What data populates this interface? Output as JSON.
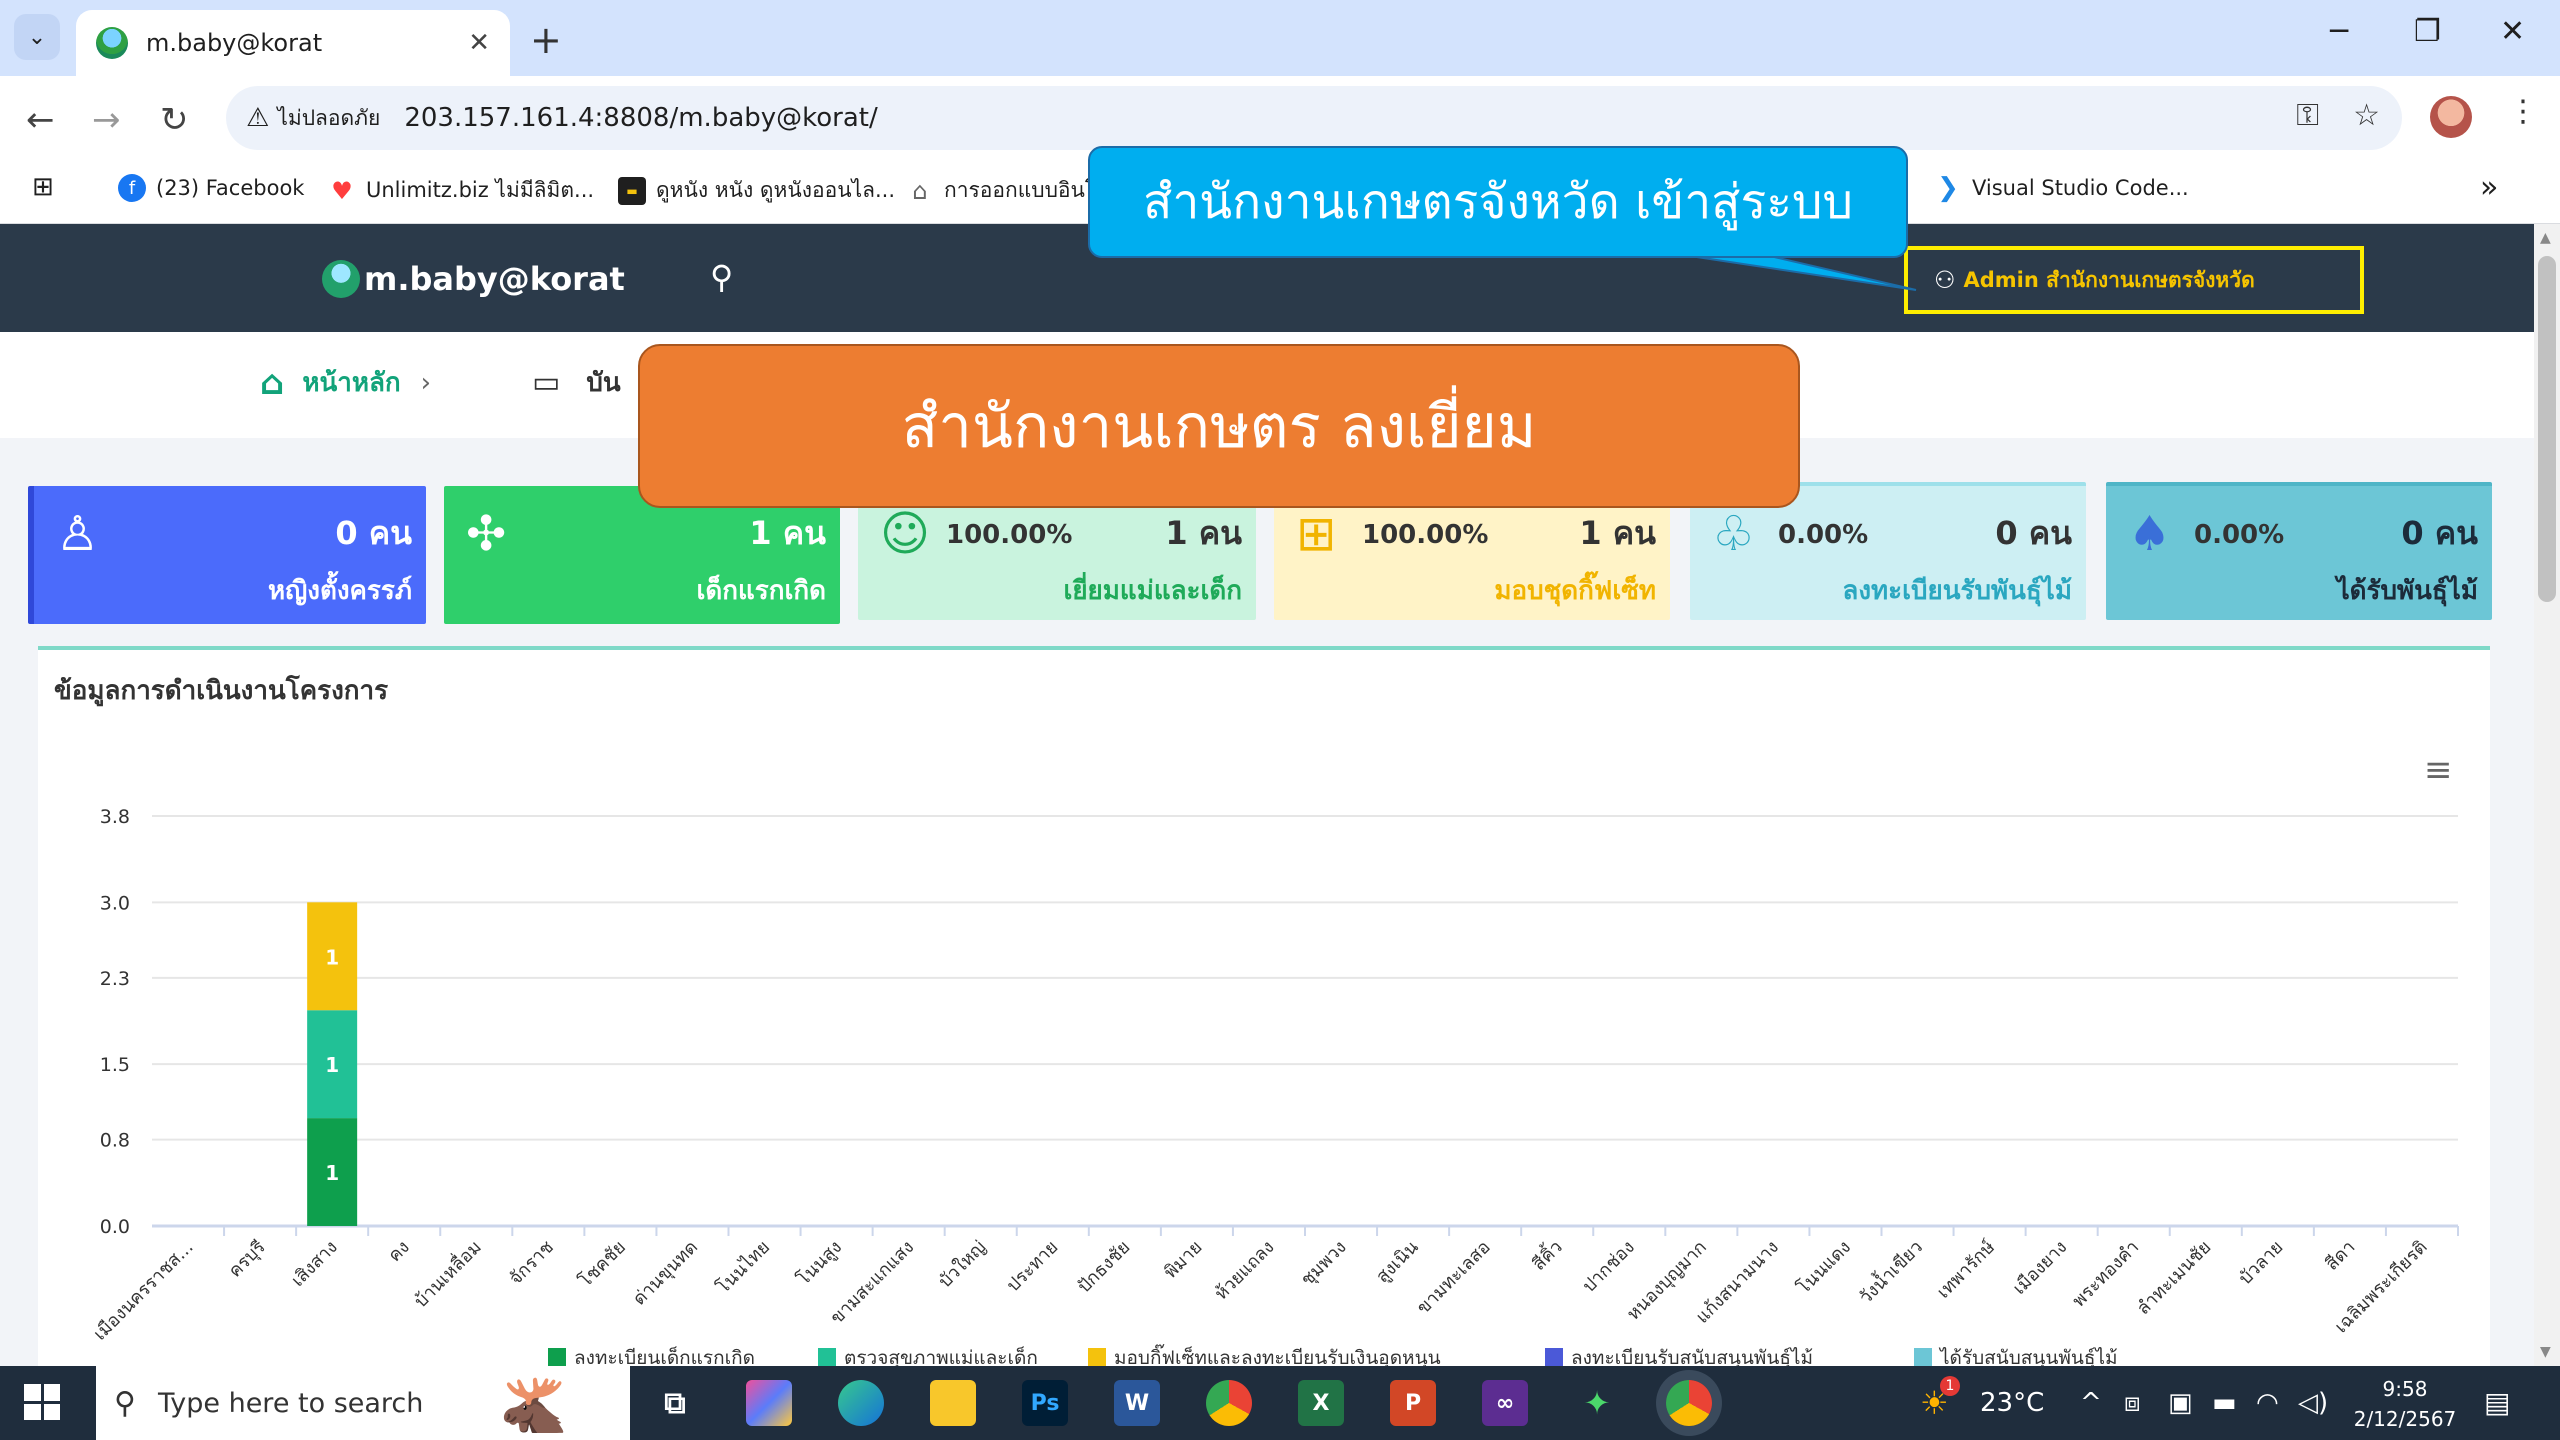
{
  "browser": {
    "tab_title": "m.baby@korat",
    "tab_close": "✕",
    "new_tab": "+",
    "security_warning": "ไม่ปลอดภัย",
    "url": "203.157.161.4:8808/m.baby@korat/",
    "bookmarks": [
      {
        "label": "(23) Facebook",
        "color": "#1877f2"
      },
      {
        "label": "Unlimitz.biz ไม่มีลิมิต...",
        "color": "#ff3d3d"
      },
      {
        "label": "ดูหนัง หนัง ดูหนังออนไล...",
        "color": "#1f1f1f"
      },
      {
        "label": "การออกแบบอินโ",
        "color": "#666666"
      },
      {
        "label": "Visual Studio Code...",
        "color": "#1e88e5"
      }
    ],
    "more_bookmarks": "»"
  },
  "site": {
    "logo_text": "m.baby@korat",
    "admin_label": "Admin สำนักงานเกษตรจังหวัด",
    "breadcrumb": {
      "home": "หน้าหลัก",
      "second": "บัน"
    }
  },
  "stats": [
    {
      "count": "0 คน",
      "label": "หญิงตั้งครรภ์",
      "pct": "",
      "icon": "pregnant-icon",
      "bg": "#4b6bfb",
      "fg": "#ffffff"
    },
    {
      "count": "1 คน",
      "label": "เด็กแรกเกิด",
      "pct": "",
      "icon": "baby-icon",
      "bg": "#2fcf6b",
      "fg": "#ffffff"
    },
    {
      "count": "1 คน",
      "label": "เยี่ยมแม่และเด็ก",
      "pct": "100.00%",
      "icon": "mother-child-icon",
      "bg": "#c9f3de",
      "fg": "#1faa59"
    },
    {
      "count": "1 คน",
      "label": "มอบชุดกิ๊ฟเซ็ท",
      "pct": "100.00%",
      "icon": "gift-icon",
      "bg": "#fff3c7",
      "fg": "#f1b400"
    },
    {
      "count": "0 คน",
      "label": "ลงทะเบียนรับพันธุ์ไม้",
      "pct": "0.00%",
      "icon": "tree-register-icon",
      "bg": "#cdeff3",
      "fg": "#2aa7c0"
    },
    {
      "count": "0 คน",
      "label": "ได้รับพันธุ์ไม้",
      "pct": "0.00%",
      "icon": "tree-icon",
      "bg": "#6cc6d6",
      "fg": "#1c4f8a"
    }
  ],
  "card": {
    "title": "ข้อมูลการดำเนินงานโครงการ"
  },
  "chart_data": {
    "type": "bar",
    "stacked": true,
    "ylim": [
      0,
      3.8
    ],
    "yticks": [
      "0.0",
      "0.8",
      "1.5",
      "2.3",
      "3.0",
      "3.8"
    ],
    "categories": [
      "เมืองนครราชส...",
      "ครบุรี",
      "เสิงสาง",
      "คง",
      "บ้านเหลื่อม",
      "จักราช",
      "โชคชัย",
      "ด่านขุนทด",
      "โนนไทย",
      "โนนสูง",
      "ขามสะแกแสง",
      "บัวใหญ่",
      "ประทาย",
      "ปักธงชัย",
      "พิมาย",
      "ห้วยแถลง",
      "ชุมพวง",
      "สูงเนิน",
      "ขามทะเลสอ",
      "สีคิ้ว",
      "ปากช่อง",
      "หนองบุญมาก",
      "แก้งสนามนาง",
      "โนนแดง",
      "วังน้ำเขียว",
      "เทพารักษ์",
      "เมืองยาง",
      "พระทองคำ",
      "ลำทะเมนชัย",
      "บัวลาย",
      "สีดา",
      "เฉลิมพระเกียรติ"
    ],
    "series": [
      {
        "name": "ลงทะเบียนเด็กแรกเกิด",
        "color": "#0e9f4d",
        "values": [
          0,
          0,
          1,
          0,
          0,
          0,
          0,
          0,
          0,
          0,
          0,
          0,
          0,
          0,
          0,
          0,
          0,
          0,
          0,
          0,
          0,
          0,
          0,
          0,
          0,
          0,
          0,
          0,
          0,
          0,
          0,
          0
        ]
      },
      {
        "name": "ตรวจสุขภาพแม่และเด็ก",
        "color": "#21c196",
        "values": [
          0,
          0,
          1,
          0,
          0,
          0,
          0,
          0,
          0,
          0,
          0,
          0,
          0,
          0,
          0,
          0,
          0,
          0,
          0,
          0,
          0,
          0,
          0,
          0,
          0,
          0,
          0,
          0,
          0,
          0,
          0,
          0
        ]
      },
      {
        "name": "มอบกิ๊ฟเซ็ทและลงทะเบียนรับเงินอุดหนุน",
        "color": "#f4c20d",
        "values": [
          0,
          0,
          1,
          0,
          0,
          0,
          0,
          0,
          0,
          0,
          0,
          0,
          0,
          0,
          0,
          0,
          0,
          0,
          0,
          0,
          0,
          0,
          0,
          0,
          0,
          0,
          0,
          0,
          0,
          0,
          0,
          0
        ]
      },
      {
        "name": "ลงทะเบียนรับสนับสนุนพันธุ์ไม้",
        "color": "#4b59d8",
        "values": [
          0,
          0,
          0,
          0,
          0,
          0,
          0,
          0,
          0,
          0,
          0,
          0,
          0,
          0,
          0,
          0,
          0,
          0,
          0,
          0,
          0,
          0,
          0,
          0,
          0,
          0,
          0,
          0,
          0,
          0,
          0,
          0
        ]
      },
      {
        "name": "ได้รับสนับสนุนพันธุ์ไม้",
        "color": "#6cc6d6",
        "values": [
          0,
          0,
          0,
          0,
          0,
          0,
          0,
          0,
          0,
          0,
          0,
          0,
          0,
          0,
          0,
          0,
          0,
          0,
          0,
          0,
          0,
          0,
          0,
          0,
          0,
          0,
          0,
          0,
          0,
          0,
          0,
          0
        ]
      }
    ]
  },
  "callouts": {
    "blue": "สำนักงานเกษตรจังหวัด เข้าสู่ระบบ",
    "orange": "สำนักงานเกษตร ลงเยี่ยม"
  },
  "taskbar": {
    "search_placeholder": "Type here to search",
    "weather": "23°C",
    "notification_count": "1",
    "time": "9:58",
    "date": "2/12/2567"
  }
}
